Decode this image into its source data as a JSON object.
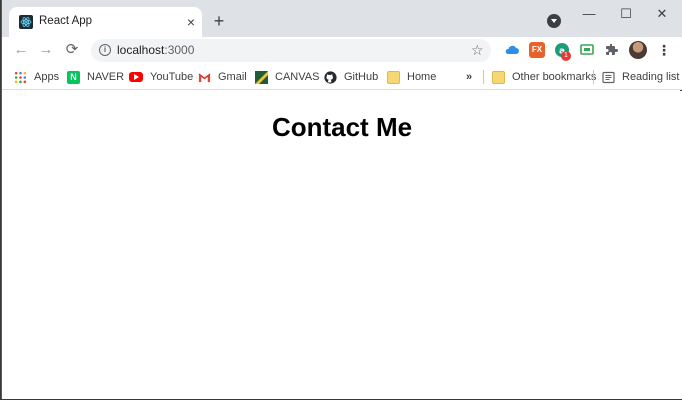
{
  "tab": {
    "title": "React App",
    "close": "×"
  },
  "new_tab": "+",
  "window_controls": {
    "minimize": "—",
    "maximize": "☐",
    "close": "✕"
  },
  "toolbar": {
    "back": "←",
    "forward": "→",
    "reload": "⟳",
    "url_host": "localhost",
    "url_port": ":3000",
    "star": "☆",
    "menu": "⋮"
  },
  "bookmarks": [
    {
      "label": "Apps",
      "icon": "apps-grid-icon"
    },
    {
      "label": "NAVER",
      "icon": "naver-icon"
    },
    {
      "label": "YouTube",
      "icon": "youtube-icon"
    },
    {
      "label": "Gmail",
      "icon": "gmail-icon"
    },
    {
      "label": "CANVAS",
      "icon": "canvas-icon"
    },
    {
      "label": "GitHub",
      "icon": "github-icon"
    },
    {
      "label": "Home",
      "icon": "folder-icon"
    }
  ],
  "bookmarks_overflow": "»",
  "other_bookmarks": "Other bookmarks",
  "reading_list": "Reading list",
  "extension_badge": "1",
  "page": {
    "heading": "Contact Me"
  },
  "colors": {
    "tabstrip": "#dee1e6",
    "naver": "#03c75a",
    "youtube": "#ff0000",
    "folder": "#f7d774"
  }
}
